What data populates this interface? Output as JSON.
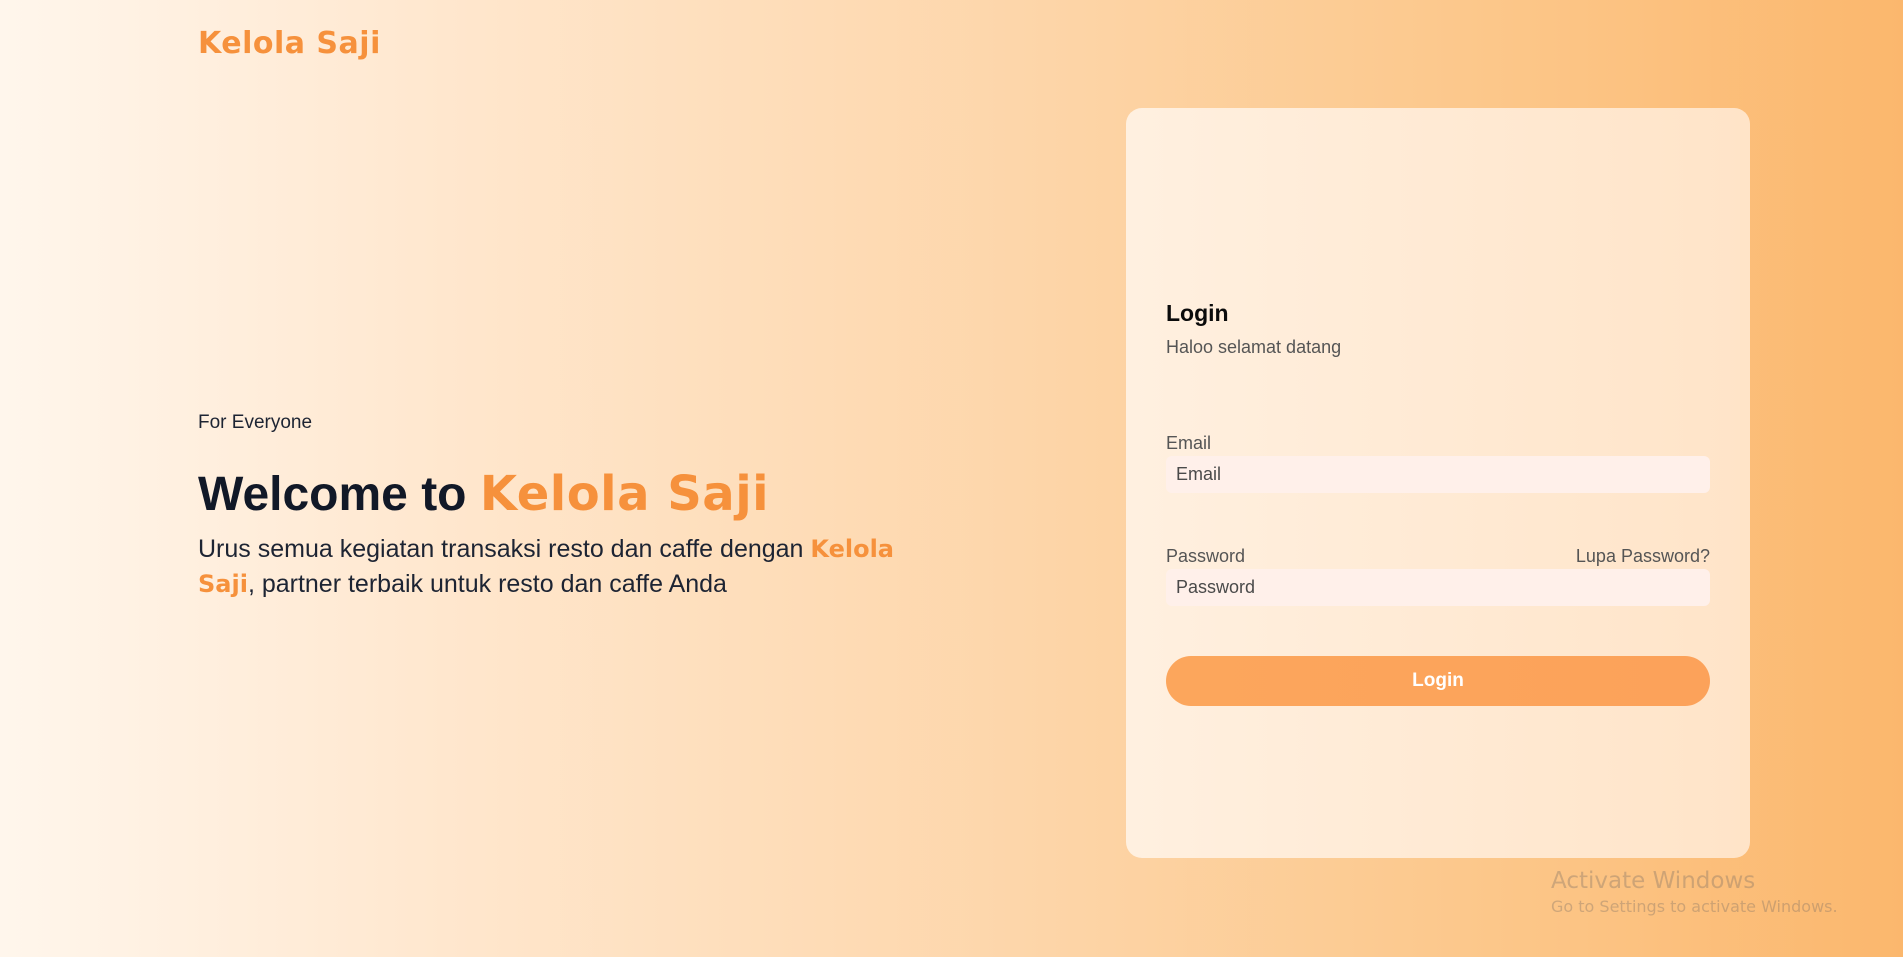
{
  "header": {
    "brand": "Kelola Saji"
  },
  "hero": {
    "tagline": "For Everyone",
    "headline_prefix": "Welcome to ",
    "headline_brand": "Kelola Saji",
    "description_prefix": "Urus semua kegiatan transaksi resto dan caffe dengan ",
    "description_brand": "Kelola Saji",
    "description_suffix": ", partner terbaik untuk resto dan caffe Anda"
  },
  "login": {
    "title": "Login",
    "subtitle": "Haloo selamat datang",
    "email_label": "Email",
    "email_placeholder": "Email",
    "email_value": "",
    "password_label": "Password",
    "password_placeholder": "Password",
    "password_value": "",
    "forgot_label": "Lupa Password?",
    "button_label": "Login"
  },
  "watermark": {
    "title": "Activate Windows",
    "subtitle": "Go to Settings to activate Windows."
  },
  "colors": {
    "brand": "#f6913c",
    "button": "#fca65c",
    "input_bg": "#fff0ea",
    "text_dark": "#111827"
  }
}
